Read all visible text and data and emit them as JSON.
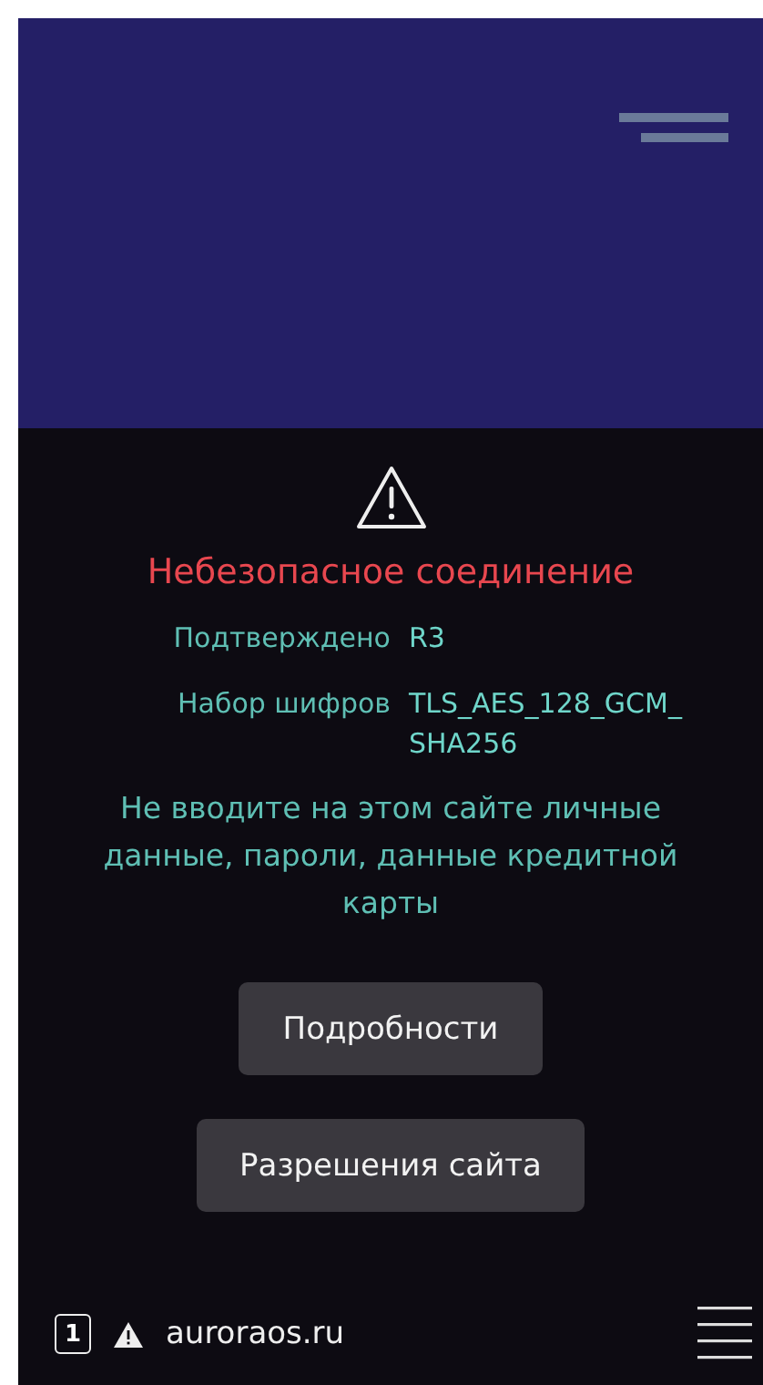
{
  "security_panel": {
    "title": "Небезопасное соединение",
    "details": [
      {
        "label": "Подтверждено",
        "value": "R3"
      },
      {
        "label": "Набор шифров",
        "value": "TLS_AES_128_GCM_ SHA256"
      }
    ],
    "warning": "Не вводите на этом сайте личные данные, пароли, данные кредитной карты",
    "buttons": [
      "Подробности",
      "Разрешения сайта"
    ]
  },
  "toolbar": {
    "tab_count": "1",
    "url": "auroraos.ru"
  }
}
